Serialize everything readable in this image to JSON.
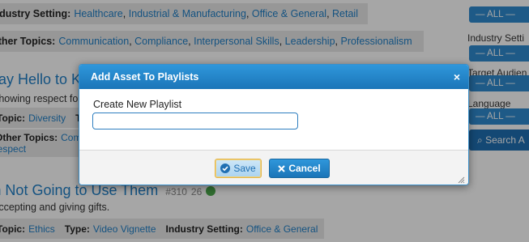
{
  "background": {
    "row1": {
      "label": "Industry Setting:",
      "links": [
        "Healthcare",
        "Industrial & Manufacturing",
        "Office & General",
        "Retail"
      ]
    },
    "row2": {
      "label": "Other Topics:",
      "links": [
        "Communication",
        "Compliance",
        "Interpersonal Skills",
        "Leadership",
        "Professionalism"
      ]
    },
    "item1": {
      "title": "Say Hello to Ke",
      "desc": "Showing respect fo",
      "topic_label": "Topic:",
      "topic_value": "Diversity",
      "type_label": "T",
      "other_label": "Other Topics:",
      "other_value": "Com",
      "other_value2": "Respect"
    },
    "item2": {
      "title": "I'm Not Going to Use Them",
      "id": "#310",
      "duration": "26",
      "desc": "Accepting and giving gifts.",
      "topic_label": "Topic:",
      "topic_value": "Ethics",
      "type_label": "Type:",
      "type_value": "Video Vignette",
      "industry_label": "Industry Setting:",
      "industry_value": "Office & General"
    },
    "sidebar": {
      "all1": "— ALL —",
      "industry_label": "Industry Setti",
      "all2": "— ALL —",
      "audience_label": "Target Audien",
      "all3": "— ALL —",
      "language_label": "Language",
      "all4": "— ALL —",
      "search_label": "Search A"
    }
  },
  "dialog": {
    "title": "Add Asset To Playlists",
    "close": "×",
    "field_label": "Create New Playlist",
    "field_value": "",
    "save_label": "Save",
    "cancel_label": "Cancel"
  }
}
